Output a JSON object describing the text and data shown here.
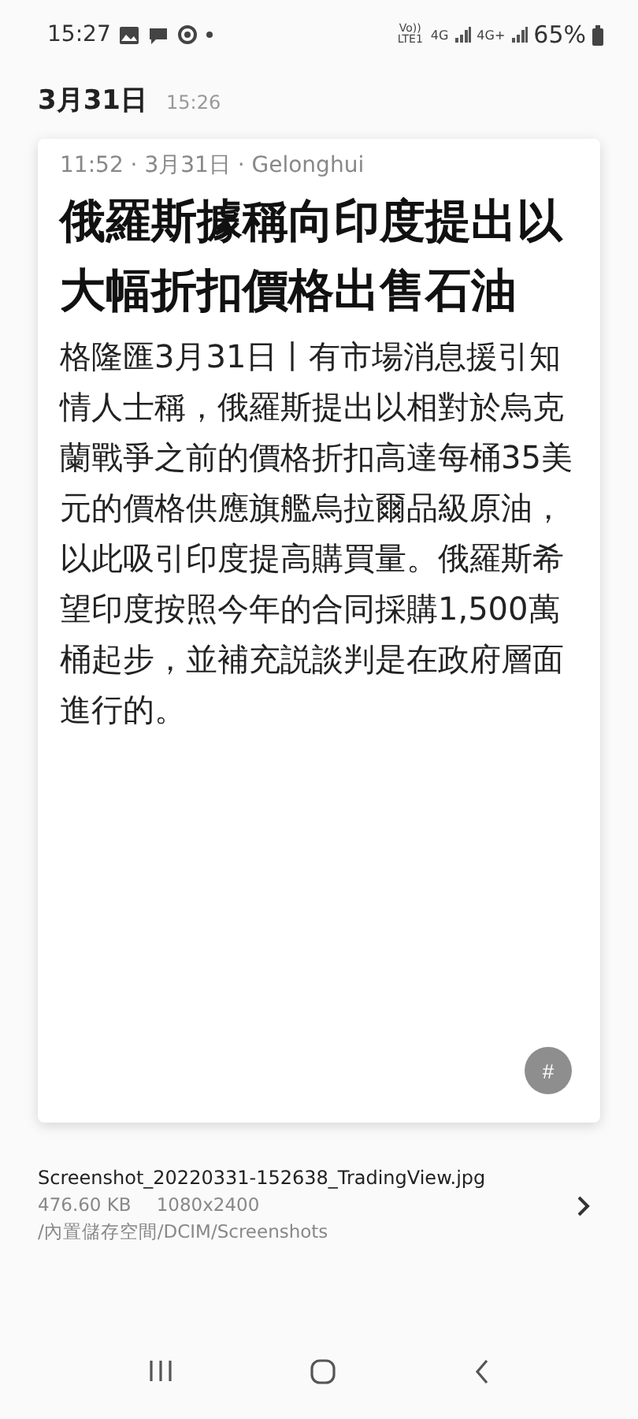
{
  "status_bar": {
    "time": "15:27",
    "volte": "Vo)) LTE1",
    "network_1": "4G",
    "network_2": "4G+",
    "battery": "65%"
  },
  "header": {
    "date": "3月31日",
    "time": "15:26"
  },
  "card": {
    "meta": "11:52 · 3月31日 · Gelonghui",
    "title": "俄羅斯據稱向印度提出以大幅折扣價格出售石油",
    "body": "格隆匯3月31日丨有市場消息援引知情人士稱，俄羅斯提出以相對於烏克蘭戰爭之前的價格折扣高達每桶35美元的價格供應旗艦烏拉爾品級原油，以此吸引印度提高購買量。俄羅斯希望印度按照今年的合同採購1,500萬桶起步，並補充説談判是在政府層面進行的。",
    "tag_button": "#"
  },
  "file_info": {
    "name": "Screenshot_20220331-152638_TradingView.jpg",
    "size": "476.60 KB",
    "resolution": "1080x2400",
    "path": "/內置儲存空間/DCIM/Screenshots"
  }
}
